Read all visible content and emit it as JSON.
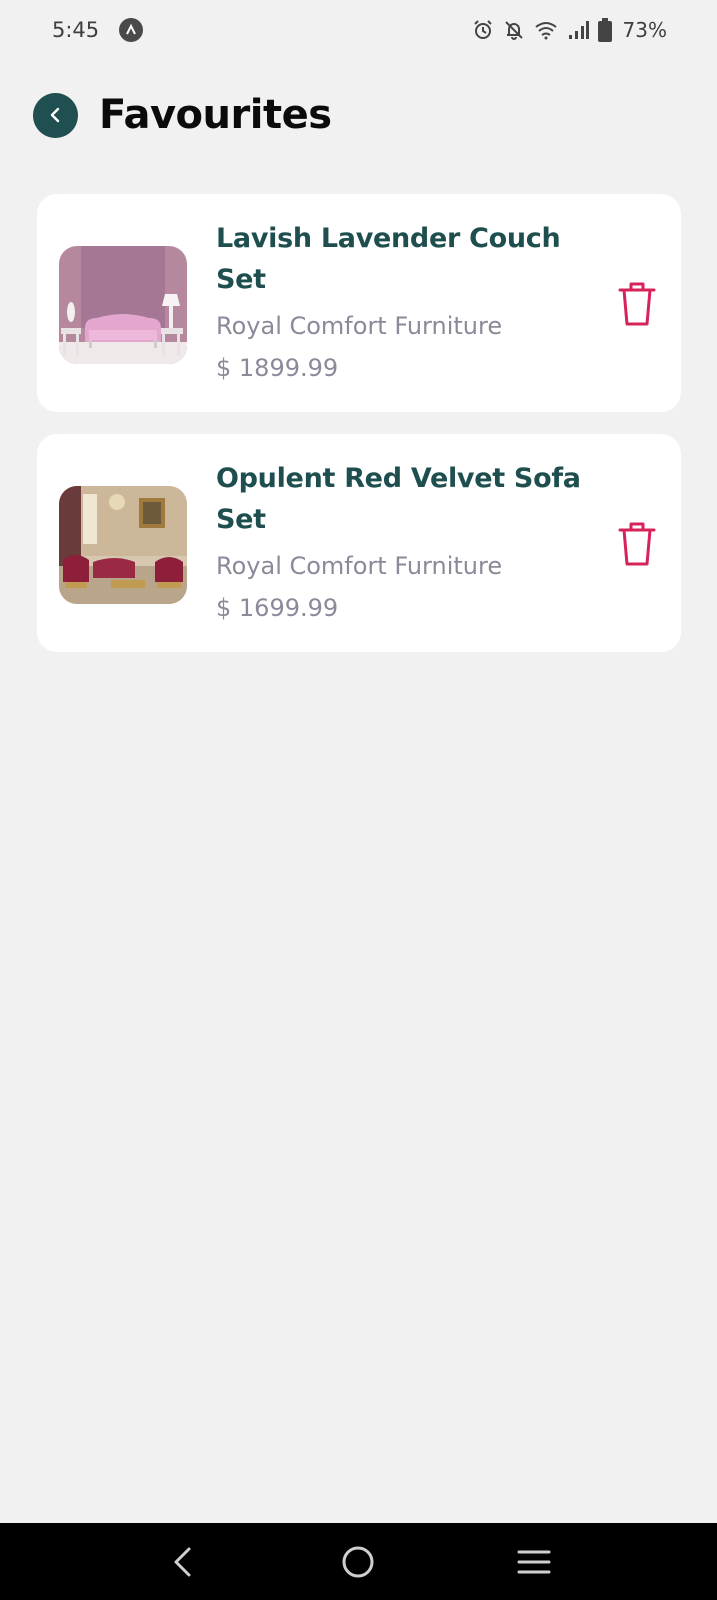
{
  "status_bar": {
    "time": "5:45",
    "battery": "73%",
    "icons": [
      "app-indicator-icon",
      "alarm-icon",
      "notifications-off-icon",
      "wifi-icon",
      "signal-icon",
      "battery-icon"
    ]
  },
  "header": {
    "title": "Favourites",
    "back_icon": "chevron-left-icon"
  },
  "favourites": [
    {
      "name": "Lavish Lavender Couch Set",
      "brand": "Royal Comfort Furniture",
      "price": "$ 1899.99",
      "image": "lavender-couch-image"
    },
    {
      "name": "Opulent Red Velvet Sofa Set",
      "brand": "Royal Comfort Furniture",
      "price": "$ 1699.99",
      "image": "red-velvet-sofa-image"
    }
  ],
  "colors": {
    "background": "#f1f1f2",
    "accent": "#1f4f50",
    "delete": "#d6245a",
    "secondary_text": "#8a8a9a"
  },
  "nav_bar": {
    "icons": [
      "nav-back-icon",
      "nav-home-icon",
      "nav-recents-icon"
    ]
  }
}
